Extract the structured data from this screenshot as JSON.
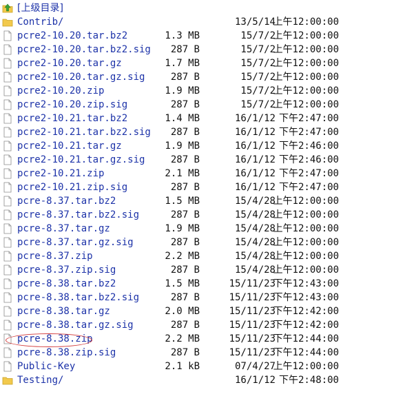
{
  "parent": {
    "label": "[上级目录]",
    "icon": "up-folder-icon"
  },
  "entries": [
    {
      "name": "Contrib/",
      "type": "folder",
      "size": "",
      "date": "13/5/14",
      "time": "上午12:00:00"
    },
    {
      "name": "pcre2-10.20.tar.bz2",
      "type": "file",
      "size": "1.3 MB",
      "date": "15/7/2",
      "time": "上午12:00:00"
    },
    {
      "name": "pcre2-10.20.tar.bz2.sig",
      "type": "file",
      "size": "287 B",
      "date": "15/7/2",
      "time": "上午12:00:00"
    },
    {
      "name": "pcre2-10.20.tar.gz",
      "type": "file",
      "size": "1.7 MB",
      "date": "15/7/2",
      "time": "上午12:00:00"
    },
    {
      "name": "pcre2-10.20.tar.gz.sig",
      "type": "file",
      "size": "287 B",
      "date": "15/7/2",
      "time": "上午12:00:00"
    },
    {
      "name": "pcre2-10.20.zip",
      "type": "file",
      "size": "1.9 MB",
      "date": "15/7/2",
      "time": "上午12:00:00"
    },
    {
      "name": "pcre2-10.20.zip.sig",
      "type": "file",
      "size": "287 B",
      "date": "15/7/2",
      "time": "上午12:00:00"
    },
    {
      "name": "pcre2-10.21.tar.bz2",
      "type": "file",
      "size": "1.4 MB",
      "date": "16/1/12",
      "time": "下午2:47:00"
    },
    {
      "name": "pcre2-10.21.tar.bz2.sig",
      "type": "file",
      "size": "287 B",
      "date": "16/1/12",
      "time": "下午2:47:00"
    },
    {
      "name": "pcre2-10.21.tar.gz",
      "type": "file",
      "size": "1.9 MB",
      "date": "16/1/12",
      "time": "下午2:46:00"
    },
    {
      "name": "pcre2-10.21.tar.gz.sig",
      "type": "file",
      "size": "287 B",
      "date": "16/1/12",
      "time": "下午2:46:00"
    },
    {
      "name": "pcre2-10.21.zip",
      "type": "file",
      "size": "2.1 MB",
      "date": "16/1/12",
      "time": "下午2:47:00"
    },
    {
      "name": "pcre2-10.21.zip.sig",
      "type": "file",
      "size": "287 B",
      "date": "16/1/12",
      "time": "下午2:47:00"
    },
    {
      "name": "pcre-8.37.tar.bz2",
      "type": "file",
      "size": "1.5 MB",
      "date": "15/4/28",
      "time": "上午12:00:00"
    },
    {
      "name": "pcre-8.37.tar.bz2.sig",
      "type": "file",
      "size": "287 B",
      "date": "15/4/28",
      "time": "上午12:00:00"
    },
    {
      "name": "pcre-8.37.tar.gz",
      "type": "file",
      "size": "1.9 MB",
      "date": "15/4/28",
      "time": "上午12:00:00"
    },
    {
      "name": "pcre-8.37.tar.gz.sig",
      "type": "file",
      "size": "287 B",
      "date": "15/4/28",
      "time": "上午12:00:00"
    },
    {
      "name": "pcre-8.37.zip",
      "type": "file",
      "size": "2.2 MB",
      "date": "15/4/28",
      "time": "上午12:00:00"
    },
    {
      "name": "pcre-8.37.zip.sig",
      "type": "file",
      "size": "287 B",
      "date": "15/4/28",
      "time": "上午12:00:00"
    },
    {
      "name": "pcre-8.38.tar.bz2",
      "type": "file",
      "size": "1.5 MB",
      "date": "15/11/23",
      "time": "下午12:43:00"
    },
    {
      "name": "pcre-8.38.tar.bz2.sig",
      "type": "file",
      "size": "287 B",
      "date": "15/11/23",
      "time": "下午12:43:00"
    },
    {
      "name": "pcre-8.38.tar.gz",
      "type": "file",
      "size": "2.0 MB",
      "date": "15/11/23",
      "time": "下午12:42:00"
    },
    {
      "name": "pcre-8.38.tar.gz.sig",
      "type": "file",
      "size": "287 B",
      "date": "15/11/23",
      "time": "下午12:42:00"
    },
    {
      "name": "pcre-8.38.zip",
      "type": "file",
      "size": "2.2 MB",
      "date": "15/11/23",
      "time": "下午12:44:00"
    },
    {
      "name": "pcre-8.38.zip.sig",
      "type": "file",
      "size": "287 B",
      "date": "15/11/23",
      "time": "下午12:44:00"
    },
    {
      "name": "Public-Key",
      "type": "file",
      "size": "2.1 kB",
      "date": "07/4/27",
      "time": "上午12:00:00"
    },
    {
      "name": "Testing/",
      "type": "folder",
      "size": "",
      "date": "16/1/12",
      "time": "下午2:48:00"
    }
  ],
  "colors": {
    "link": "#1c32a8",
    "text": "#111111",
    "folder": "#f2c94c",
    "highlight": "#d23a3a"
  }
}
